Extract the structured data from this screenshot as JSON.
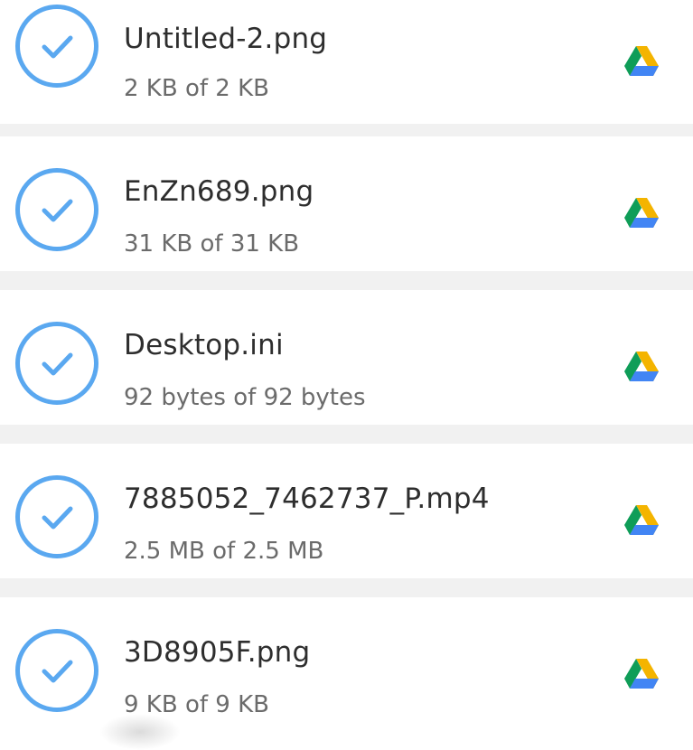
{
  "transfers": {
    "items": [
      {
        "name": "Untitled-2.png",
        "size": "2 KB of 2 KB",
        "status_icon": "check-circle-icon",
        "destination_icon": "google-drive-icon"
      },
      {
        "name": "EnZn689.png",
        "size": "31 KB of 31 KB",
        "status_icon": "check-circle-icon",
        "destination_icon": "google-drive-icon"
      },
      {
        "name": "Desktop.ini",
        "size": "92 bytes of 92 bytes",
        "status_icon": "check-circle-icon",
        "destination_icon": "google-drive-icon"
      },
      {
        "name": "7885052_7462737_P.mp4",
        "size": "2.5 MB of 2.5 MB",
        "status_icon": "check-circle-icon",
        "destination_icon": "google-drive-icon"
      },
      {
        "name": "3D8905F.png",
        "size": "9 KB of 9 KB",
        "status_icon": "check-circle-icon",
        "destination_icon": "google-drive-icon"
      }
    ]
  },
  "colors": {
    "check_blue": "#5aa8f0",
    "drive_green": "#0f9d58",
    "drive_yellow": "#f4b400",
    "drive_blue": "#4285f4"
  }
}
